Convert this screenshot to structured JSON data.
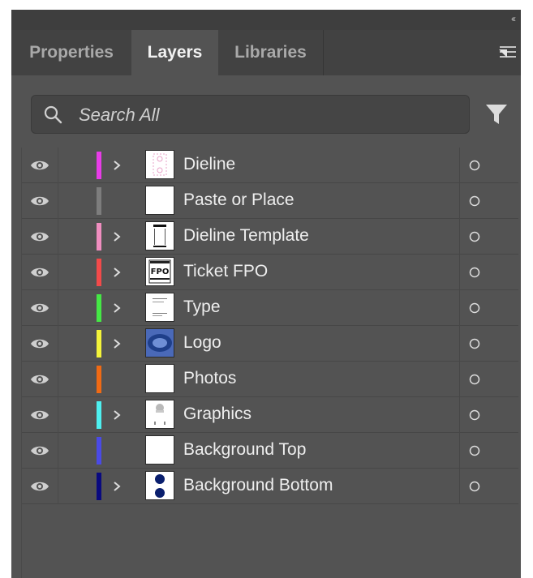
{
  "panel": {
    "collapse_glyph": "‹‹",
    "tabs": [
      {
        "label": "Properties"
      },
      {
        "label": "Layers"
      },
      {
        "label": "Libraries"
      }
    ],
    "active_tab": "Layers",
    "menu_icon": "hamburger-menu-icon"
  },
  "search": {
    "placeholder": "Search All",
    "icon": "search-icon",
    "filter_icon": "filter-icon"
  },
  "layers": [
    {
      "name": "Dieline",
      "color": "#e83ce8",
      "expandable": true,
      "thumb": "dieline"
    },
    {
      "name": "Paste or Place",
      "color": "#7d7d7d",
      "expandable": false,
      "thumb": "blank"
    },
    {
      "name": "Dieline Template",
      "color": "#f08ec0",
      "expandable": true,
      "thumb": "template"
    },
    {
      "name": "Ticket FPO",
      "color": "#f24a4a",
      "expandable": true,
      "thumb": "fpo",
      "thumb_text": "FPO"
    },
    {
      "name": "Type",
      "color": "#45e845",
      "expandable": true,
      "thumb": "type"
    },
    {
      "name": "Logo",
      "color": "#f4f43a",
      "expandable": true,
      "thumb": "logo"
    },
    {
      "name": "Photos",
      "color": "#f06a14",
      "expandable": false,
      "thumb": "blank"
    },
    {
      "name": "Graphics",
      "color": "#4ef0f0",
      "expandable": true,
      "thumb": "graphics"
    },
    {
      "name": "Background Top",
      "color": "#4a4ae6",
      "expandable": false,
      "thumb": "blank"
    },
    {
      "name": "Background Bottom",
      "color": "#0a0a80",
      "expandable": true,
      "thumb": "bgbottom"
    }
  ],
  "colors": {
    "panel_bg": "#535353",
    "tabbar_bg": "#424242",
    "active_tab_text": "#f2f2f2",
    "inactive_tab_text": "#a9a9a9"
  }
}
